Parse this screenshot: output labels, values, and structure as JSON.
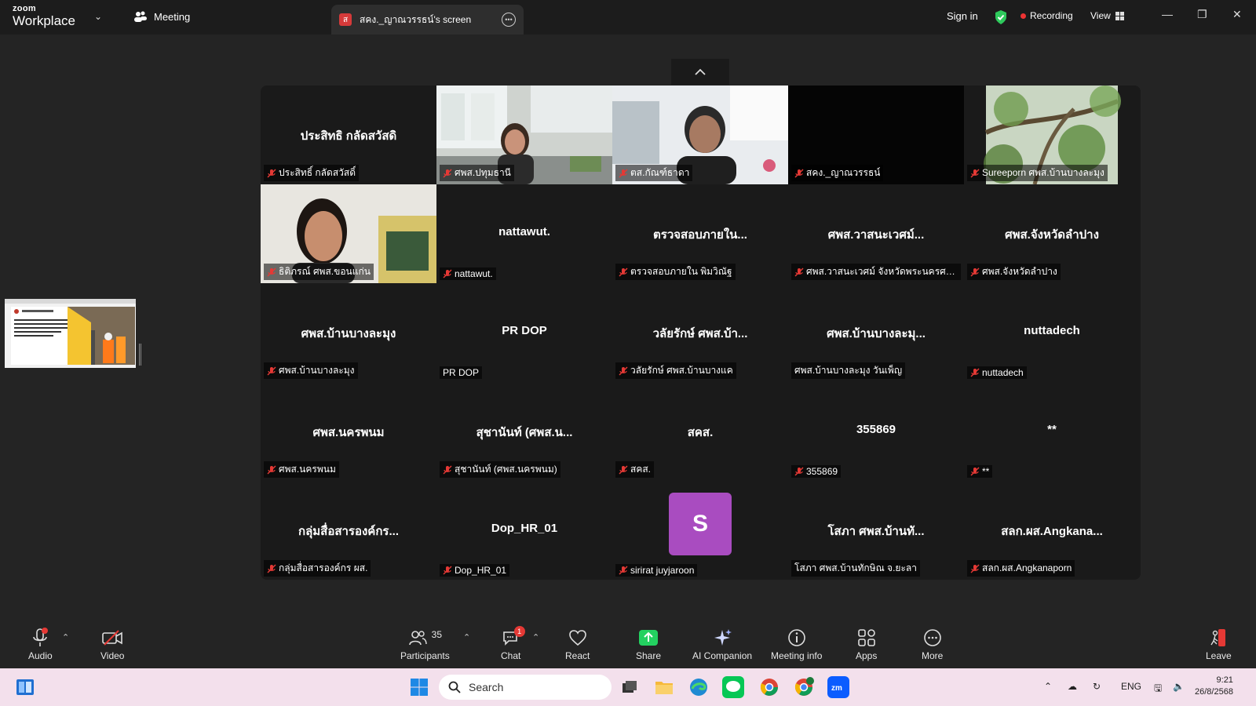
{
  "titlebar": {
    "logo_line1": "zoom",
    "logo_line2": "Workplace",
    "meeting_tab": "Meeting",
    "screen_tab_initial": "ส",
    "screen_tab": "สคง._ญาณวรรธน์'s screen",
    "sign_in": "Sign in",
    "recording": "Recording",
    "view": "View"
  },
  "participants": [
    {
      "big": "ประสิทธิ กลัดสวัสดิ",
      "label": "ประสิทธิ์ กลัดสวัสดิ์",
      "muted": true,
      "video": false
    },
    {
      "big": "",
      "label": "ศพส.ปทุมธานี",
      "muted": true,
      "video": true,
      "scene": "office-woman"
    },
    {
      "big": "",
      "label": "ตส.กัณฑ์ธาดา",
      "muted": true,
      "video": true,
      "scene": "office-woman2"
    },
    {
      "big": "",
      "label": "สคง._ญาณวรรธน์",
      "muted": true,
      "video": true,
      "scene": "black"
    },
    {
      "big": "",
      "label": "Sureeporn ศพส.บ้านบางละมุง",
      "muted": true,
      "video": true,
      "scene": "tree"
    },
    {
      "big": "",
      "label": "ธิติภรณ์ ศพส.ขอนแก่น",
      "muted": true,
      "video": true,
      "scene": "woman-face"
    },
    {
      "big": "nattawut.",
      "label": "nattawut.",
      "muted": true,
      "video": false
    },
    {
      "big": "ตรวจสอบภายใน...",
      "label": "ตรวจสอบภายใน พิมวิณัฐ",
      "muted": true,
      "video": false
    },
    {
      "big": "ศพส.วาสนะเวศม์...",
      "label": "ศพส.วาสนะเวศม์ จังหวัดพระนครศรีอยุ...",
      "muted": true,
      "video": false
    },
    {
      "big": "ศพส.จังหวัดลำปาง",
      "label": "ศพส.จังหวัดลำปาง",
      "muted": true,
      "video": false
    },
    {
      "big": "ศพส.บ้านบางละมุง",
      "label": "ศพส.บ้านบางละมุง",
      "muted": true,
      "video": false
    },
    {
      "big": "PR DOP",
      "label": "PR DOP",
      "muted": false,
      "video": false
    },
    {
      "big": "วลัยรักษ์ ศพส.บ้า...",
      "label": "วลัยรักษ์ ศพส.บ้านบางแค",
      "muted": true,
      "video": false
    },
    {
      "big": "ศพส.บ้านบางละมุ...",
      "label": "ศพส.บ้านบางละมุง วันเพ็ญ",
      "muted": false,
      "video": false
    },
    {
      "big": "nuttadech",
      "label": "nuttadech",
      "muted": true,
      "video": false
    },
    {
      "big": "ศพส.นครพนม",
      "label": "ศพส.นครพนม",
      "muted": true,
      "video": false
    },
    {
      "big": "สุชานันท์ (ศพส.น...",
      "label": "สุชานันท์ (ศพส.นครพนม)",
      "muted": true,
      "video": false
    },
    {
      "big": "สคส.",
      "label": "สคส.",
      "muted": true,
      "video": false
    },
    {
      "big": "355869",
      "label": "355869",
      "muted": true,
      "video": false
    },
    {
      "big": "**",
      "label": "**",
      "muted": true,
      "video": false
    },
    {
      "big": "กลุ่มสื่อสารองค์กร...",
      "label": "กลุ่มสื่อสารองค์กร ผส.",
      "muted": true,
      "video": false
    },
    {
      "big": "Dop_HR_01",
      "label": "Dop_HR_01",
      "muted": true,
      "video": false
    },
    {
      "big": "",
      "label": "sirirat juyjaroon",
      "muted": true,
      "video": false,
      "avatar": "S"
    },
    {
      "big": "โสภา ศพส.บ้านทั...",
      "label": "โสภา ศพส.บ้านทักษิณ จ.ยะลา",
      "muted": false,
      "video": false
    },
    {
      "big": "สลก.ผส.Angkana...",
      "label": "สลก.ผส.Angkanaporn",
      "muted": true,
      "video": false
    }
  ],
  "toolbar": {
    "audio": "Audio",
    "video": "Video",
    "participants": "Participants",
    "participants_count": "35",
    "chat": "Chat",
    "chat_badge": "1",
    "react": "React",
    "share": "Share",
    "ai_companion": "AI Companion",
    "meeting_info": "Meeting info",
    "apps": "Apps",
    "more": "More",
    "leave": "Leave"
  },
  "taskbar": {
    "search_placeholder": "Search",
    "lang": "ENG",
    "time": "9:21",
    "date": "26/8/2568"
  },
  "colors": {
    "background": "#242424",
    "gallery": "#1a1a1a",
    "share_green": "#23d160",
    "mute_red": "#e53935",
    "avatar_purple": "#a94cc0",
    "taskbar": "#f3e0ec"
  }
}
